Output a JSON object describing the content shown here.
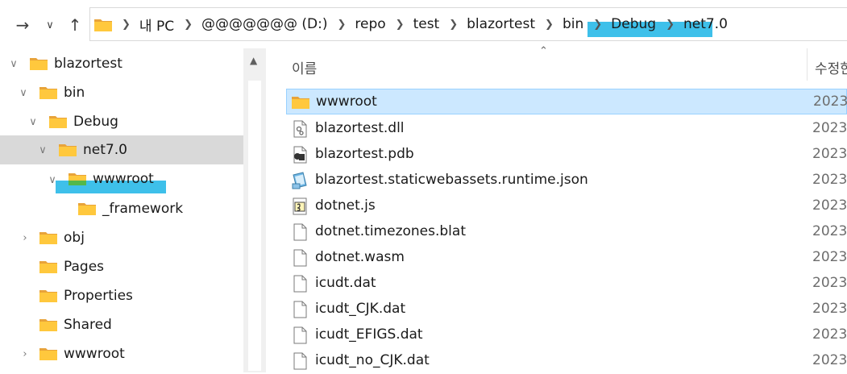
{
  "colors": {
    "highlight": "#3ec0ea",
    "tree_selected": "#d9d9d9",
    "row_selected": "#cce8ff",
    "folder": "#ffc83d"
  },
  "nav": {
    "back_icon": "back-arrow-icon",
    "recent_icon": "chevron-down-icon",
    "up_icon": "up-arrow-icon",
    "breadcrumb": [
      "내 PC",
      "@@@@@@@ (D:)",
      "repo",
      "test",
      "blazortest",
      "bin",
      "Debug",
      "net7.0"
    ]
  },
  "tree": {
    "items": [
      {
        "label": "blazortest",
        "expanded": true
      },
      {
        "label": "bin",
        "expanded": true
      },
      {
        "label": "Debug",
        "expanded": true
      },
      {
        "label": "net7.0",
        "expanded": true,
        "selected": true
      },
      {
        "label": "wwwroot",
        "expanded": true
      },
      {
        "label": "_framework"
      },
      {
        "label": "obj",
        "collapsed": true
      },
      {
        "label": "Pages"
      },
      {
        "label": "Properties"
      },
      {
        "label": "Shared"
      },
      {
        "label": "wwwroot",
        "collapsed": true
      }
    ]
  },
  "list": {
    "columns": {
      "name": "이름",
      "date": "수정한"
    },
    "files": [
      {
        "name": "wwwroot",
        "icon": "folder-icon",
        "date": "2023",
        "selected": true
      },
      {
        "name": "blazortest.dll",
        "icon": "dll-file-icon",
        "date": "2023"
      },
      {
        "name": "blazortest.pdb",
        "icon": "pdb-file-icon",
        "date": "2023"
      },
      {
        "name": "blazortest.staticwebassets.runtime.json",
        "icon": "json-file-icon",
        "date": "2023"
      },
      {
        "name": "dotnet.js",
        "icon": "js-file-icon",
        "date": "2023"
      },
      {
        "name": "dotnet.timezones.blat",
        "icon": "generic-file-icon",
        "date": "2023"
      },
      {
        "name": "dotnet.wasm",
        "icon": "generic-file-icon",
        "date": "2023"
      },
      {
        "name": "icudt.dat",
        "icon": "generic-file-icon",
        "date": "2023"
      },
      {
        "name": "icudt_CJK.dat",
        "icon": "generic-file-icon",
        "date": "2023"
      },
      {
        "name": "icudt_EFIGS.dat",
        "icon": "generic-file-icon",
        "date": "2023"
      },
      {
        "name": "icudt_no_CJK.dat",
        "icon": "generic-file-icon",
        "date": "2023"
      }
    ]
  }
}
